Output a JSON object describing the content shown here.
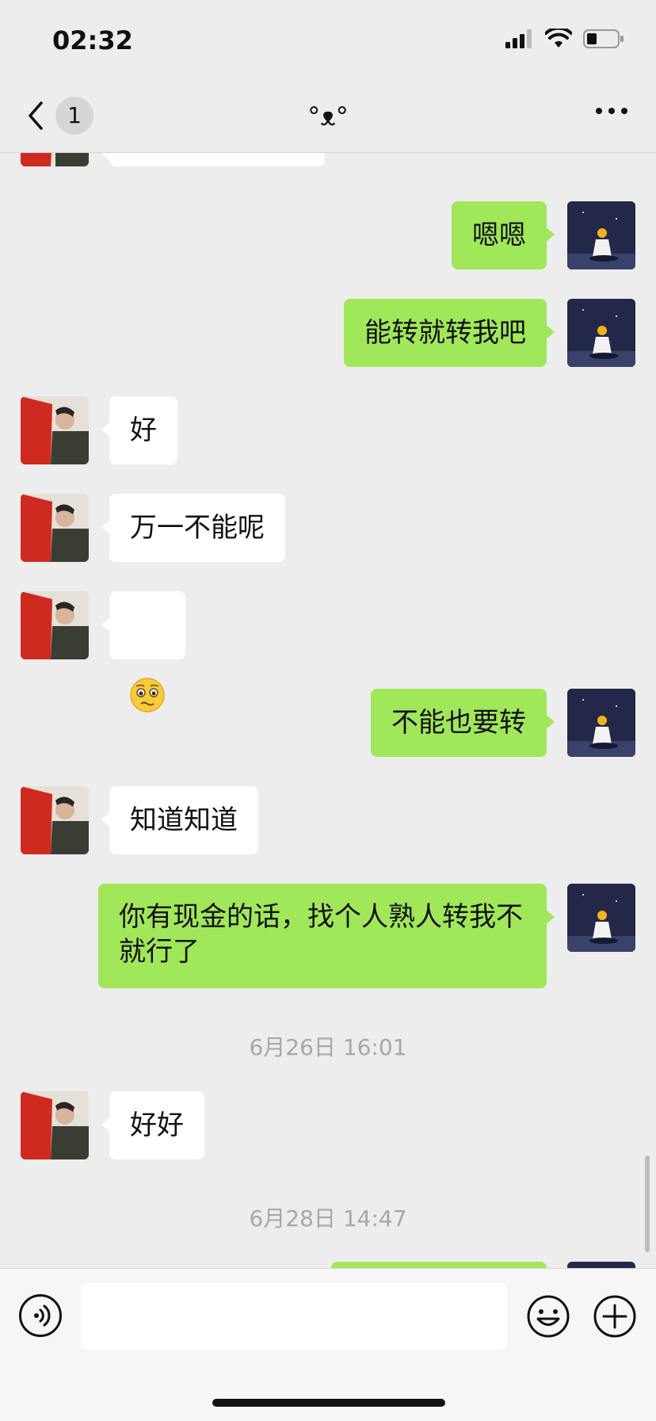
{
  "status_bar": {
    "time": "02:32",
    "icons": [
      "signal-icon",
      "wifi-icon",
      "battery-icon"
    ]
  },
  "nav": {
    "back_icon": "chevron-left-icon",
    "unread_count": "1",
    "title": "°ᴥ°",
    "more_icon": "more-dots-icon"
  },
  "colors": {
    "my_bubble": "#a0e75a",
    "other_bubble": "#ffffff",
    "background": "#ededed"
  },
  "messages": [
    {
      "sender": "me",
      "text": "嗯嗯"
    },
    {
      "sender": "me",
      "text": "能转就转我吧"
    },
    {
      "sender": "other",
      "text": "好"
    },
    {
      "sender": "other",
      "text": "万一不能呢"
    },
    {
      "sender": "other",
      "text": "🥺",
      "kind": "emoji"
    },
    {
      "sender": "me",
      "text": "不能也要转"
    },
    {
      "sender": "other",
      "text": "知道知道"
    },
    {
      "sender": "me",
      "text": "你有现金的话，找个人熟人转我不就行了"
    },
    {
      "sender": "other",
      "text": "好好"
    }
  ],
  "timestamps": [
    "6月26日 16:01",
    "6月28日 14:47"
  ],
  "input_bar": {
    "voice_icon": "voice-icon",
    "input_value": "",
    "emoji_icon": "emoji-icon",
    "plus_icon": "plus-icon"
  }
}
